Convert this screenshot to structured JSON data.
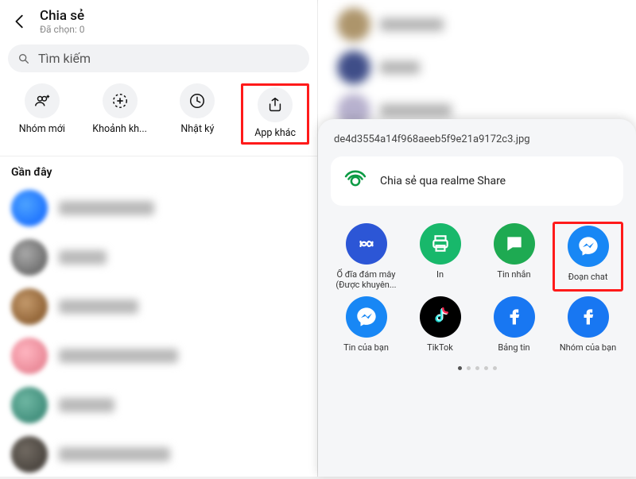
{
  "left": {
    "title": "Chia sẻ",
    "subtitle": "Đã chọn: 0",
    "search_placeholder": "Tìm kiếm",
    "actions": [
      {
        "label": "Nhóm mới"
      },
      {
        "label": "Khoảnh kh..."
      },
      {
        "label": "Nhật ký"
      },
      {
        "label": "App khác"
      }
    ],
    "recent_label": "Gần đây"
  },
  "right": {
    "filename": "de4d3554a14f968aeeb5f9e21a9172c3.jpg",
    "realme_label": "Chia sẻ qua realme Share",
    "apps": [
      {
        "label": "Ổ đĩa đám mây (Được khuyên..."
      },
      {
        "label": "In"
      },
      {
        "label": "Tin nhắn"
      },
      {
        "label": "Đoạn chat"
      },
      {
        "label": "Tin của bạn"
      },
      {
        "label": "TikTok"
      },
      {
        "label": "Bảng tin"
      },
      {
        "label": "Nhóm của bạn"
      }
    ]
  }
}
